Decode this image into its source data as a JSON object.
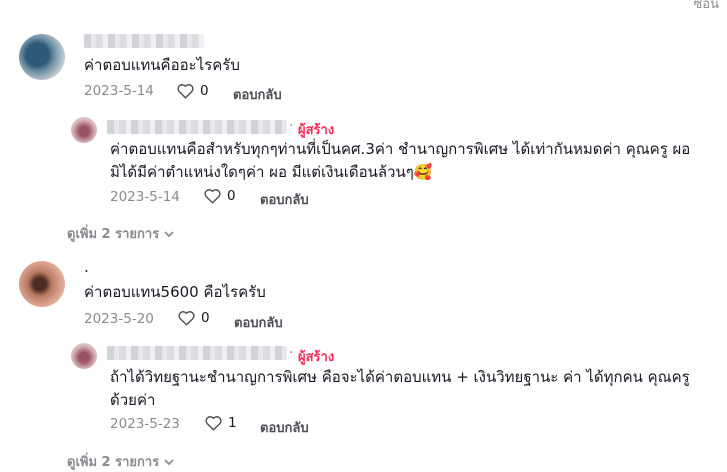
{
  "top_cut_text": "ซ่อน",
  "threads": [
    {
      "comment": {
        "text": "ค่าตอบแทนคืออะไรครับ",
        "date": "2023-5-14",
        "likes": "0",
        "reply_label": "ตอบกลับ"
      },
      "reply": {
        "badge_sep": "·",
        "badge": "ผู้สร้าง",
        "text_line1": "ค่าตอบแทนคือสำหรับทุกๆท่านที่เป็นคศ.3ค่า ชำนาญการพิเศษ ได้เท่ากันหมดค่า คุณครู ผอ",
        "text_line2": "มิได้มีค่าตำแหน่งใดๆค่า ผอ มีแต่เงินเดือนล้วนๆ🥰",
        "date": "2023-5-14",
        "likes": "0",
        "reply_label": "ตอบกลับ"
      },
      "more_replies": "ดูเพิ่ม 2 รายการ"
    },
    {
      "comment": {
        "name_text": ".",
        "text": "ค่าตอบแทน5600 คือไรครับ",
        "date": "2023-5-20",
        "likes": "0",
        "reply_label": "ตอบกลับ"
      },
      "reply": {
        "badge_sep": "·",
        "badge": "ผู้สร้าง",
        "text_line1": "ถ้าได้วิทยฐานะชำนาญการพิเศษ คือจะได้ค่าตอบแทน + เงินวิทยฐานะ ค่า ได้ทุกคน คุณครู",
        "text_line2": "ด้วยค่า",
        "date": "2023-5-23",
        "likes": "1",
        "reply_label": "ตอบกลับ"
      },
      "more_replies": "ดูเพิ่ม 2 รายการ"
    }
  ],
  "colors": {
    "text": "#161823",
    "muted": "#8a8b91",
    "creator_badge": "#fe2c55"
  },
  "icons": [
    "heart-icon",
    "chevron-down-icon"
  ]
}
